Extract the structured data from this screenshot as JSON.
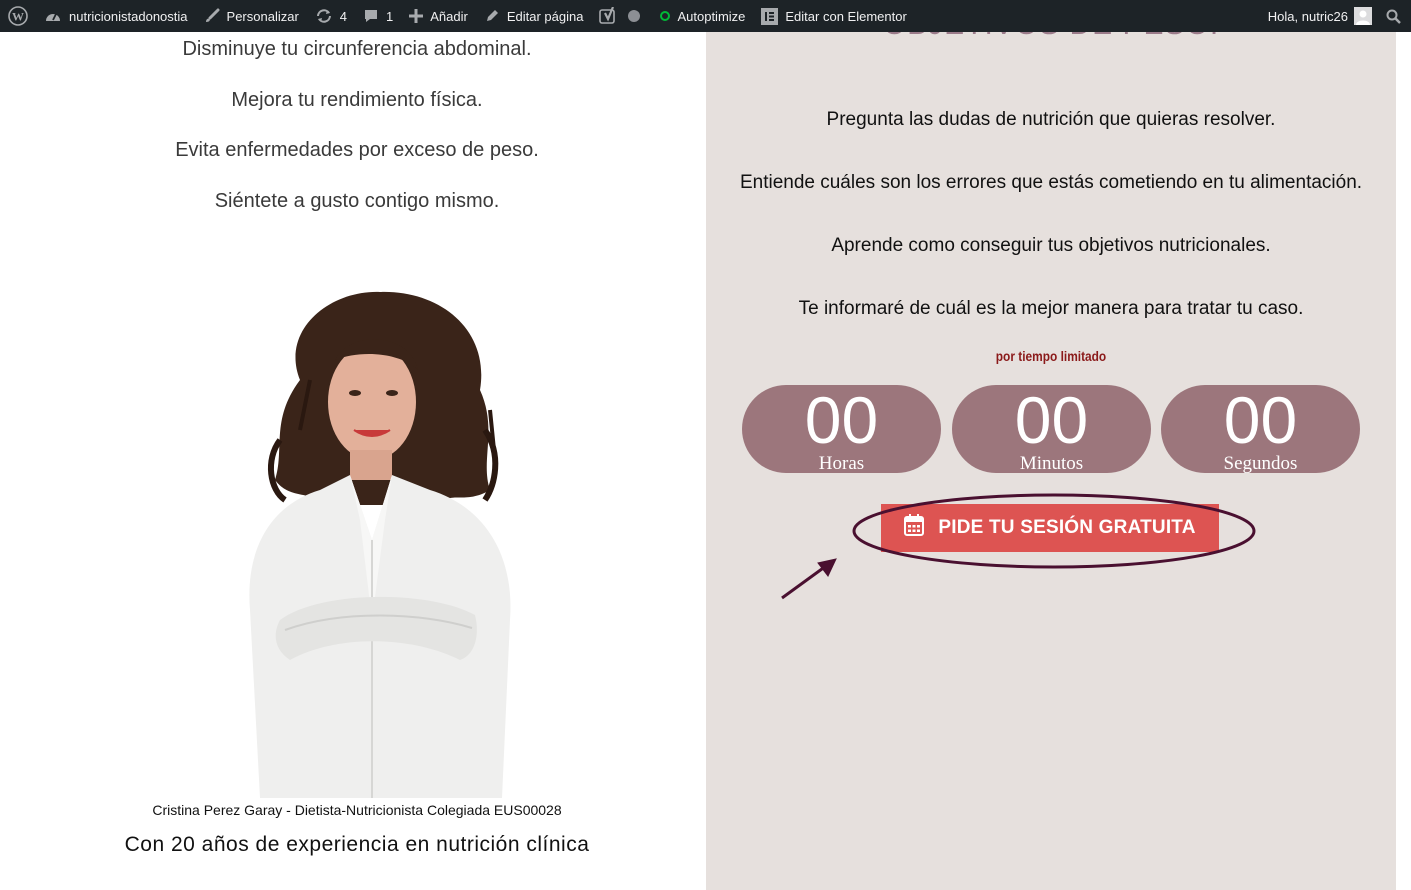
{
  "admin_bar": {
    "site_name": "nutricionistadonostia",
    "customize": "Personalizar",
    "updates_count": "4",
    "comments_count": "1",
    "add_new": "Añadir",
    "edit_page": "Editar página",
    "autoptimize": "Autoptimize",
    "edit_elementor": "Editar con Elementor",
    "greeting": "Hola, nutric26"
  },
  "left": {
    "benefits": [
      "Disminuye tu circunferencia abdominal.",
      "Mejora tu rendimiento física.",
      "Evita enfermedades por exceso de peso.",
      "Siéntete a gusto contigo mismo."
    ],
    "caption_name": "Cristina Perez Garay - Dietista-Nutricionista Colegiada EUS00028",
    "caption_experience": "Con 20 años de experiencia en nutrición clínica"
  },
  "right": {
    "heading": "OBJETIVOS DE PESO.",
    "points": [
      "Pregunta las dudas de nutrición que quieras resolver.",
      "Entiende cuáles son los errores que estás cometiendo en tu   alimentación.",
      "Aprende como conseguir tus objetivos nutricionales.",
      "Te informaré de cuál es la mejor manera para tratar tu caso."
    ],
    "limited_time": "por tiempo limitado",
    "countdown": [
      {
        "value": "00",
        "label": "Horas"
      },
      {
        "value": "00",
        "label": "Minutos"
      },
      {
        "value": "00",
        "label": "Segundos"
      }
    ],
    "cta_label": "PIDE TU SESIÓN GRATUITA"
  },
  "colors": {
    "adminbar_bg": "#1d2327",
    "panel_bg": "#e6e0dd",
    "countdown_bg": "#9c767c",
    "cta_bg": "#dd5452",
    "annotation": "#4a1030",
    "limited_text": "#8b1a1a"
  },
  "icons": [
    "wordpress-icon",
    "dashboard-icon",
    "brush-icon",
    "updates-icon",
    "comments-icon",
    "plus-icon",
    "pencil-icon",
    "yoast-icon",
    "elementor-icon",
    "search-icon",
    "calendar-icon"
  ]
}
